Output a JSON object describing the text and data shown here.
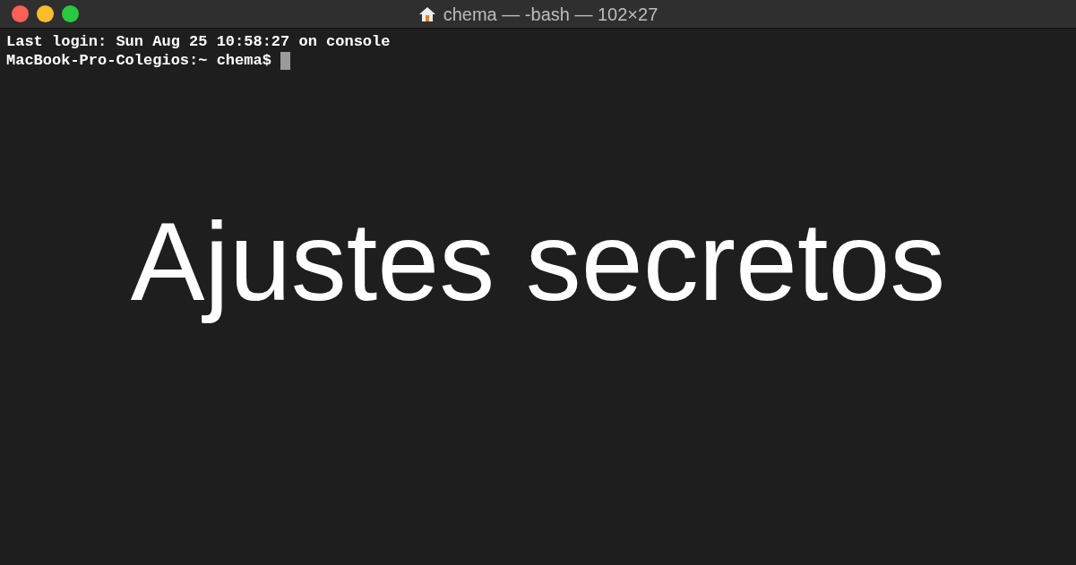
{
  "window": {
    "title": "chema — -bash — 102×27"
  },
  "terminal": {
    "lines": [
      "Last login: Sun Aug 25 10:58:27 on console",
      "MacBook-Pro-Colegios:~ chema$ "
    ],
    "cursor": true
  },
  "overlay_title": "Ajustes secretos"
}
